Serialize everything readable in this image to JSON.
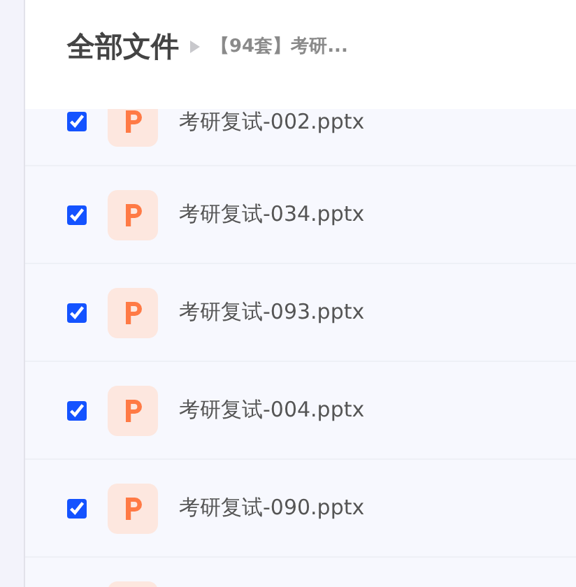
{
  "header": {
    "title": "全部文件",
    "breadcrumb": "【94套】考研..."
  },
  "files": [
    {
      "name": "考研复试-002.pptx",
      "checked": true
    },
    {
      "name": "考研复试-034.pptx",
      "checked": true
    },
    {
      "name": "考研复试-093.pptx",
      "checked": true
    },
    {
      "name": "考研复试-004.pptx",
      "checked": true
    },
    {
      "name": "考研复试-090.pptx",
      "checked": true
    }
  ]
}
